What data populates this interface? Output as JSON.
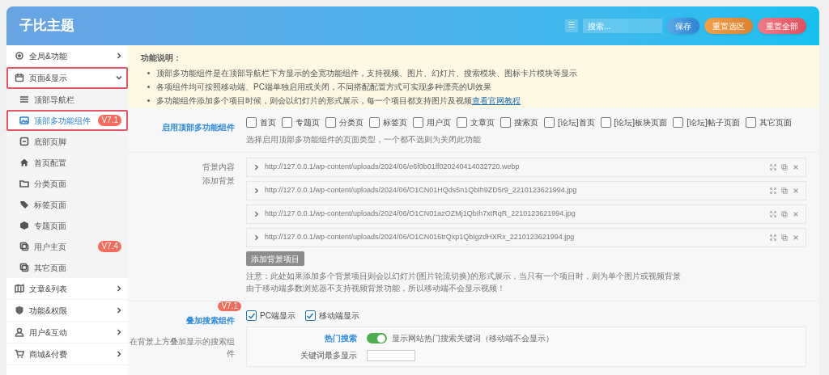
{
  "header": {
    "title": "子比主题",
    "menu_icon_label": "☰",
    "search": {
      "placeholder": "搜索..."
    },
    "buttons": [
      {
        "label": "保存",
        "kind": "save"
      },
      {
        "label": "重置选区",
        "kind": "reset-section"
      },
      {
        "label": "重置全部",
        "kind": "reset-all"
      }
    ]
  },
  "sidebar": {
    "items": [
      {
        "label": "全局&功能",
        "expanded": false,
        "highlighted": false
      },
      {
        "label": "页面&显示",
        "expanded": true,
        "highlighted": true,
        "children": [
          {
            "label": "顶部导航栏",
            "selected": false,
            "highlighted": false
          },
          {
            "label": "顶部多功能组件",
            "selected": true,
            "highlighted": true,
            "badge": "V7.1"
          },
          {
            "label": "底部页脚",
            "selected": false,
            "highlighted": false
          },
          {
            "label": "首页配置",
            "selected": false,
            "highlighted": false
          },
          {
            "label": "分类页面",
            "selected": false,
            "highlighted": false
          },
          {
            "label": "标签页面",
            "selected": false,
            "highlighted": false
          },
          {
            "label": "专题页面",
            "selected": false,
            "highlighted": false
          },
          {
            "label": "用户主页",
            "selected": false,
            "highlighted": false,
            "badge": "V7.4"
          },
          {
            "label": "其它页面",
            "selected": false,
            "highlighted": false
          }
        ]
      },
      {
        "label": "文章&列表",
        "expanded": false,
        "highlighted": false
      },
      {
        "label": "功能&权限",
        "expanded": false,
        "highlighted": false
      },
      {
        "label": "用户&互动",
        "expanded": false,
        "highlighted": false
      },
      {
        "label": "商城&付费",
        "expanded": false,
        "highlighted": false
      }
    ]
  },
  "notice": {
    "title": "功能说明：",
    "bullets": [
      "顶部多功能组件是在顶部导航栏下方显示的全宽功能组件，支持视频、图片、幻灯片、搜索模块、图标卡片模块等显示",
      "各项组件均可按照移动端、PC端单独启用或关闭，不同搭配配置方式可实现多种漂亮的UI效果",
      "多功能组件添加多个项目时候，则会以幻灯片的形式展示，每一个项目都支持图片及视频"
    ],
    "link": "查看官网教程"
  },
  "enable_section": {
    "label": "启用顶部多功能组件",
    "options": [
      {
        "label": "首页",
        "checked": false
      },
      {
        "label": "专题页",
        "checked": false
      },
      {
        "label": "分类页",
        "checked": false
      },
      {
        "label": "标签页",
        "checked": false
      },
      {
        "label": "用户页",
        "checked": false
      },
      {
        "label": "文章页",
        "checked": false
      },
      {
        "label": "搜索页",
        "checked": false
      },
      {
        "label": "[论坛]首页",
        "checked": false
      },
      {
        "label": "[论坛]板块页面",
        "checked": false
      },
      {
        "label": "[论坛]帖子页面",
        "checked": false
      },
      {
        "label": "其它页面",
        "checked": false
      }
    ],
    "description": "选择启用顶部多功能组件的页面类型，一个都不选则为关闭此功能"
  },
  "background_section": {
    "disabled": true,
    "label": "背景内容",
    "sublabel": "添加背景",
    "items": [
      "http://127.0.0.1/wp-content/uploads/2024/06/e6f0b01ff020240414032720.webp",
      "http://127.0.0.1/wp-content/uploads/2024/06/O1CN01HQds5n1QbIh9ZD5r9_2210123621994.jpg",
      "http://127.0.0.1/wp-content/uploads/2024/06/O1CN01azOZMj1QbIh7xtRqR_2210123621994.jpg",
      "http://127.0.0.1/wp-content/uploads/2024/06/O1CN016trQxp1QbIgzdHXRx_2210123621994.jpg"
    ],
    "add_button": "添加背景项目",
    "notes": [
      "注意：此处如果添加多个背景项目则会以幻灯片(图片轮流切换)的形式展示，当只有一个项目时，则为单个图片或视频背景",
      "由于移动端多数浏览器不支持视频背景功能，所以移动端不会显示视频！"
    ]
  },
  "search_section": {
    "label": "叠加搜索组件",
    "badge": "V7.1",
    "description": "在背景上方叠加显示的搜索组件",
    "options": [
      {
        "label": "PC端显示",
        "checked": true
      },
      {
        "label": "移动端显示",
        "checked": true
      }
    ],
    "hot_search": {
      "label": "热门搜索",
      "on": true,
      "text": "显示网站热门搜索关键词（移动端不会显示）"
    },
    "max_keywords_label": "关键词最多显示"
  }
}
